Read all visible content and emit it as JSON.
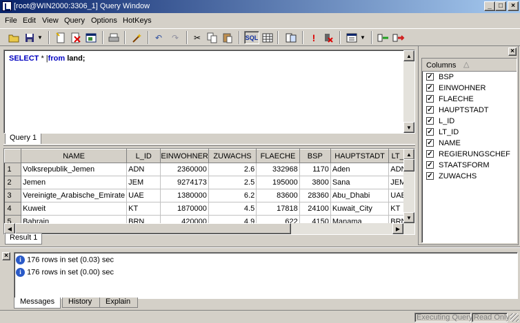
{
  "window": {
    "title": "[root@WIN2000:3306_1] Query Window"
  },
  "menu": {
    "file": "File",
    "edit": "Edit",
    "view": "View",
    "query": "Query",
    "options": "Options",
    "hotkeys": "HotKeys"
  },
  "toolbar": {
    "icons": [
      "open-folder-icon",
      "save-icon",
      "new-query-icon",
      "delete-query-icon",
      "window-icon",
      "print-icon",
      "wand-icon",
      "undo-icon",
      "redo-icon",
      "cut-icon",
      "copy-icon",
      "paste-icon",
      "sql-icon",
      "grid-icon",
      "table-icon",
      "execute-icon",
      "stop-icon",
      "view-mode-icon",
      "insert-row-icon",
      "delete-row-icon"
    ],
    "sql_label": "SQL"
  },
  "editor": {
    "kw_select": "SELECT",
    "star": "*",
    "kw_from": "from",
    "rest": "land;",
    "tab": "Query 1"
  },
  "results": {
    "tab": "Result 1",
    "columns": [
      "NAME",
      "L_ID",
      "EINWOHNER",
      "ZUWACHS",
      "FLAECHE",
      "BSP",
      "HAUPTSTADT",
      "LT_ID"
    ],
    "rows": [
      {
        "num": "1",
        "cells": [
          "Volksrepublik_Jemen",
          "ADN",
          "2360000",
          "2.6",
          "332968",
          "1170",
          "Aden",
          "ADN"
        ]
      },
      {
        "num": "2",
        "cells": [
          "Jemen",
          "JEM",
          "9274173",
          "2.5",
          "195000",
          "3800",
          "Sana",
          "JEM"
        ]
      },
      {
        "num": "3",
        "cells": [
          "Vereinigte_Arabische_Emirate",
          "UAE",
          "1380000",
          "6.2",
          "83600",
          "28360",
          "Abu_Dhabi",
          "UAE"
        ]
      },
      {
        "num": "4",
        "cells": [
          "Kuweit",
          "KT",
          "1870000",
          "4.5",
          "17818",
          "24100",
          "Kuwait_City",
          "KT"
        ]
      },
      {
        "num": "5",
        "cells": [
          "Bahrain",
          "BRN",
          "420000",
          "4.9",
          "622",
          "4150",
          "Manama",
          "BRN"
        ]
      }
    ]
  },
  "columns_panel": {
    "header": "Columns",
    "items": [
      "BSP",
      "EINWOHNER",
      "FLAECHE",
      "HAUPTSTADT",
      "L_ID",
      "LT_ID",
      "NAME",
      "REGIERUNGSCHEF",
      "STAATSFORM",
      "ZUWACHS"
    ]
  },
  "messages": {
    "lines": [
      "176 rows in set (0.03) sec",
      "176 rows in set (0.00) sec"
    ],
    "tabs": [
      "Messages",
      "History",
      "Explain"
    ]
  },
  "status": {
    "executing": "Executing Query",
    "readonly": "Read Only"
  }
}
